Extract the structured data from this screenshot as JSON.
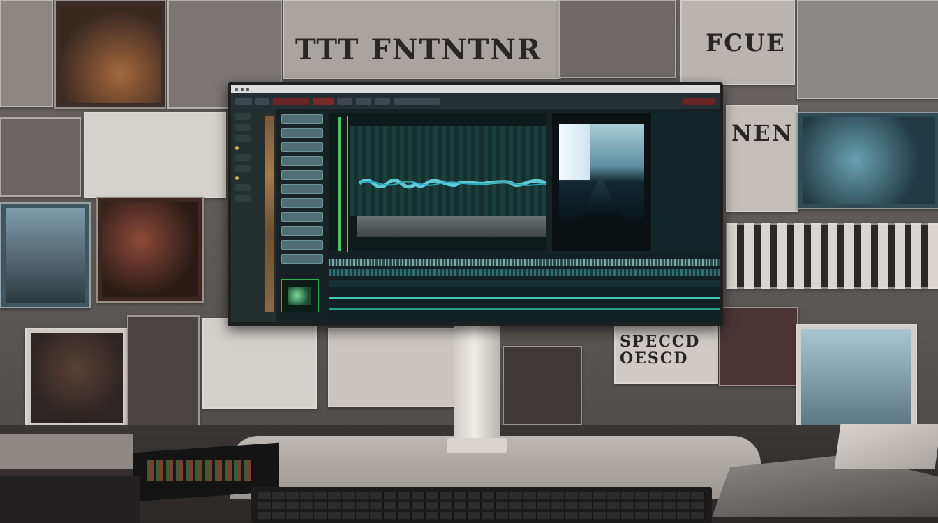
{
  "scene": {
    "description_text": "",
    "wall_banner_text": "TTT FNTNTNR",
    "poster_texts": [
      "FCUE",
      "NEN",
      "SPECCD OESCD"
    ]
  },
  "monitor": {
    "window_title": "",
    "toolbar_buttons": [
      "",
      "",
      "",
      "",
      "",
      "",
      "",
      ""
    ],
    "accent_colors": {
      "playhead": "#49c46c",
      "marker": "#c7a33a",
      "clip": "#4f6f75",
      "timeline_line": "#3ec9b0",
      "record": "#7a2a2a"
    },
    "icons": [
      "clip-thumbnail-icon",
      "playhead-marker-icon",
      "preview-frame-icon"
    ]
  }
}
